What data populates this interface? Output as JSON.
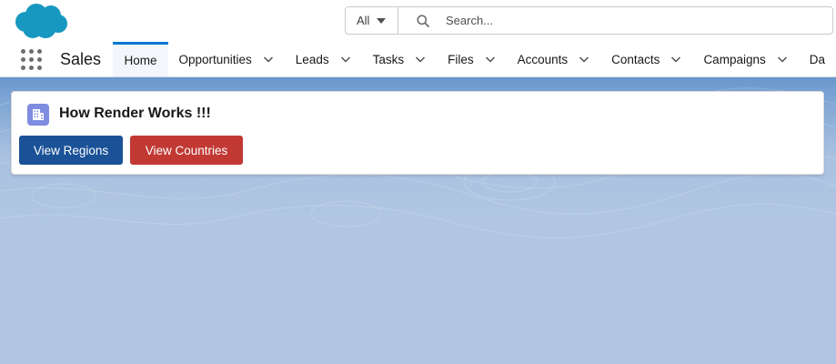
{
  "header": {
    "search_scope": "All",
    "search_placeholder": "Search...",
    "colors": {
      "brand": "#1798c1"
    },
    "logo_icon": "cloud-logo-icon"
  },
  "nav": {
    "app_name": "Sales",
    "items": [
      {
        "label": "Home",
        "active": true,
        "has_menu": false
      },
      {
        "label": "Opportunities",
        "has_menu": true
      },
      {
        "label": "Leads",
        "has_menu": true
      },
      {
        "label": "Tasks",
        "has_menu": true
      },
      {
        "label": "Files",
        "has_menu": true
      },
      {
        "label": "Accounts",
        "has_menu": true
      },
      {
        "label": "Contacts",
        "has_menu": true
      },
      {
        "label": "Campaigns",
        "has_menu": true
      },
      {
        "label": "Da",
        "has_menu": false
      }
    ]
  },
  "card": {
    "title": "How Render Works !!!",
    "icon": "building-icon",
    "buttons": {
      "regions_label": "View Regions",
      "countries_label": "View Countries"
    },
    "colors": {
      "regions": "#1b5297",
      "countries": "#c23934",
      "icon_bg": "#7f8de1"
    }
  }
}
